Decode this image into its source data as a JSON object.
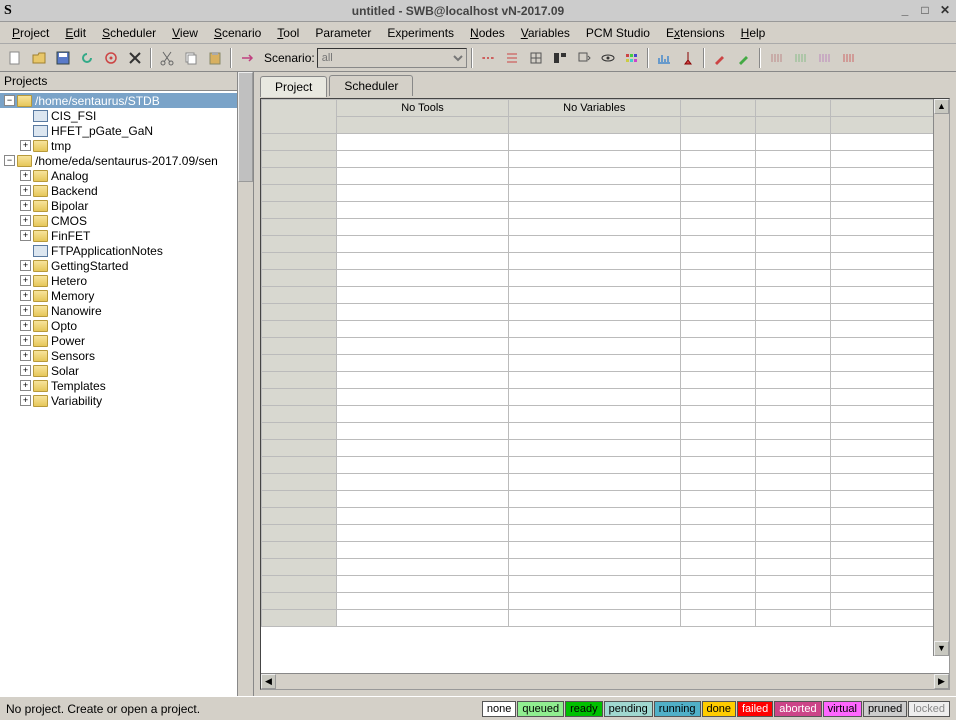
{
  "window": {
    "title": "untitled - SWB@localhost vN-2017.09",
    "app_icon": "S"
  },
  "menus": [
    {
      "label": "Project",
      "u": 0
    },
    {
      "label": "Edit",
      "u": 0
    },
    {
      "label": "Scheduler",
      "u": 0
    },
    {
      "label": "View",
      "u": 0
    },
    {
      "label": "Scenario",
      "u": 0
    },
    {
      "label": "Tool",
      "u": 0
    },
    {
      "label": "Parameter",
      "u": -1
    },
    {
      "label": "Experiments",
      "u": -1
    },
    {
      "label": "Nodes",
      "u": 0
    },
    {
      "label": "Variables",
      "u": 0
    },
    {
      "label": "PCM Studio",
      "u": -1
    },
    {
      "label": "Extensions",
      "u": 1
    },
    {
      "label": "Help",
      "u": 0
    }
  ],
  "toolbar": {
    "scenario_label": "Scenario:",
    "scenario_value": "all",
    "icons": [
      "new",
      "open",
      "save",
      "refresh",
      "target",
      "delete",
      "cut",
      "copy",
      "paste",
      "run",
      "group-a",
      "group-b",
      "group-c",
      "eye",
      "grid",
      "graph",
      "pin",
      "brush-r",
      "brush-g",
      "marks-a",
      "marks-b",
      "marks-c",
      "marks-d"
    ]
  },
  "projects": {
    "title": "Projects",
    "root1": {
      "path": "/home/sentaurus/STDB",
      "children": [
        {
          "label": "CIS_FSI",
          "type": "file"
        },
        {
          "label": "HFET_pGate_GaN",
          "type": "file"
        },
        {
          "label": "tmp",
          "type": "folder"
        }
      ]
    },
    "root2": {
      "path": "/home/eda/sentaurus-2017.09/sen",
      "children": [
        {
          "label": "Analog"
        },
        {
          "label": "Backend"
        },
        {
          "label": "Bipolar"
        },
        {
          "label": "CMOS"
        },
        {
          "label": "FinFET"
        },
        {
          "label": "FTPApplicationNotes",
          "type": "file"
        },
        {
          "label": "GettingStarted"
        },
        {
          "label": "Hetero"
        },
        {
          "label": "Memory"
        },
        {
          "label": "Nanowire"
        },
        {
          "label": "Opto"
        },
        {
          "label": "Power"
        },
        {
          "label": "Sensors"
        },
        {
          "label": "Solar"
        },
        {
          "label": "Templates"
        },
        {
          "label": "Variability"
        }
      ]
    }
  },
  "tabs": {
    "project": "Project",
    "scheduler": "Scheduler"
  },
  "grid": {
    "headers": [
      "No Tools",
      "No Variables"
    ],
    "rows": 29
  },
  "status": {
    "message": "No project. Create or open a project.",
    "chips": [
      {
        "label": "none",
        "bg": "#ffffff",
        "fg": "#000"
      },
      {
        "label": "queued",
        "bg": "#90ee90",
        "fg": "#000"
      },
      {
        "label": "ready",
        "bg": "#00c000",
        "fg": "#000"
      },
      {
        "label": "pending",
        "bg": "#a0d8d0",
        "fg": "#000"
      },
      {
        "label": "running",
        "bg": "#50b0c8",
        "fg": "#000"
      },
      {
        "label": "done",
        "bg": "#ffcc00",
        "fg": "#000"
      },
      {
        "label": "failed",
        "bg": "#ff0000",
        "fg": "#fff"
      },
      {
        "label": "aborted",
        "bg": "#cc4488",
        "fg": "#fff"
      },
      {
        "label": "virtual",
        "bg": "#ff66ff",
        "fg": "#000"
      },
      {
        "label": "pruned",
        "bg": "#cccccc",
        "fg": "#000"
      },
      {
        "label": "locked",
        "bg": "#eeeeee",
        "fg": "#888"
      }
    ]
  }
}
